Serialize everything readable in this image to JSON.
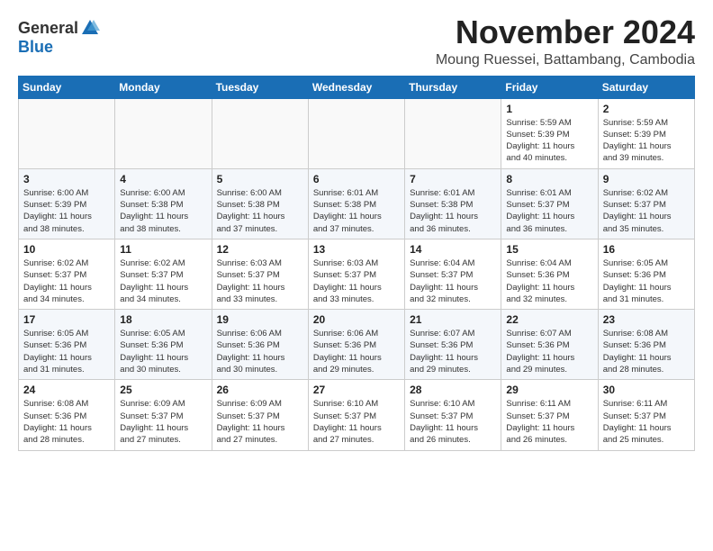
{
  "logo": {
    "general": "General",
    "blue": "Blue"
  },
  "title": "November 2024",
  "location": "Moung Ruessei, Battambang, Cambodia",
  "weekdays": [
    "Sunday",
    "Monday",
    "Tuesday",
    "Wednesday",
    "Thursday",
    "Friday",
    "Saturday"
  ],
  "weeks": [
    [
      {
        "day": "",
        "info": ""
      },
      {
        "day": "",
        "info": ""
      },
      {
        "day": "",
        "info": ""
      },
      {
        "day": "",
        "info": ""
      },
      {
        "day": "",
        "info": ""
      },
      {
        "day": "1",
        "info": "Sunrise: 5:59 AM\nSunset: 5:39 PM\nDaylight: 11 hours\nand 40 minutes."
      },
      {
        "day": "2",
        "info": "Sunrise: 5:59 AM\nSunset: 5:39 PM\nDaylight: 11 hours\nand 39 minutes."
      }
    ],
    [
      {
        "day": "3",
        "info": "Sunrise: 6:00 AM\nSunset: 5:39 PM\nDaylight: 11 hours\nand 38 minutes."
      },
      {
        "day": "4",
        "info": "Sunrise: 6:00 AM\nSunset: 5:38 PM\nDaylight: 11 hours\nand 38 minutes."
      },
      {
        "day": "5",
        "info": "Sunrise: 6:00 AM\nSunset: 5:38 PM\nDaylight: 11 hours\nand 37 minutes."
      },
      {
        "day": "6",
        "info": "Sunrise: 6:01 AM\nSunset: 5:38 PM\nDaylight: 11 hours\nand 37 minutes."
      },
      {
        "day": "7",
        "info": "Sunrise: 6:01 AM\nSunset: 5:38 PM\nDaylight: 11 hours\nand 36 minutes."
      },
      {
        "day": "8",
        "info": "Sunrise: 6:01 AM\nSunset: 5:37 PM\nDaylight: 11 hours\nand 36 minutes."
      },
      {
        "day": "9",
        "info": "Sunrise: 6:02 AM\nSunset: 5:37 PM\nDaylight: 11 hours\nand 35 minutes."
      }
    ],
    [
      {
        "day": "10",
        "info": "Sunrise: 6:02 AM\nSunset: 5:37 PM\nDaylight: 11 hours\nand 34 minutes."
      },
      {
        "day": "11",
        "info": "Sunrise: 6:02 AM\nSunset: 5:37 PM\nDaylight: 11 hours\nand 34 minutes."
      },
      {
        "day": "12",
        "info": "Sunrise: 6:03 AM\nSunset: 5:37 PM\nDaylight: 11 hours\nand 33 minutes."
      },
      {
        "day": "13",
        "info": "Sunrise: 6:03 AM\nSunset: 5:37 PM\nDaylight: 11 hours\nand 33 minutes."
      },
      {
        "day": "14",
        "info": "Sunrise: 6:04 AM\nSunset: 5:37 PM\nDaylight: 11 hours\nand 32 minutes."
      },
      {
        "day": "15",
        "info": "Sunrise: 6:04 AM\nSunset: 5:36 PM\nDaylight: 11 hours\nand 32 minutes."
      },
      {
        "day": "16",
        "info": "Sunrise: 6:05 AM\nSunset: 5:36 PM\nDaylight: 11 hours\nand 31 minutes."
      }
    ],
    [
      {
        "day": "17",
        "info": "Sunrise: 6:05 AM\nSunset: 5:36 PM\nDaylight: 11 hours\nand 31 minutes."
      },
      {
        "day": "18",
        "info": "Sunrise: 6:05 AM\nSunset: 5:36 PM\nDaylight: 11 hours\nand 30 minutes."
      },
      {
        "day": "19",
        "info": "Sunrise: 6:06 AM\nSunset: 5:36 PM\nDaylight: 11 hours\nand 30 minutes."
      },
      {
        "day": "20",
        "info": "Sunrise: 6:06 AM\nSunset: 5:36 PM\nDaylight: 11 hours\nand 29 minutes."
      },
      {
        "day": "21",
        "info": "Sunrise: 6:07 AM\nSunset: 5:36 PM\nDaylight: 11 hours\nand 29 minutes."
      },
      {
        "day": "22",
        "info": "Sunrise: 6:07 AM\nSunset: 5:36 PM\nDaylight: 11 hours\nand 29 minutes."
      },
      {
        "day": "23",
        "info": "Sunrise: 6:08 AM\nSunset: 5:36 PM\nDaylight: 11 hours\nand 28 minutes."
      }
    ],
    [
      {
        "day": "24",
        "info": "Sunrise: 6:08 AM\nSunset: 5:36 PM\nDaylight: 11 hours\nand 28 minutes."
      },
      {
        "day": "25",
        "info": "Sunrise: 6:09 AM\nSunset: 5:37 PM\nDaylight: 11 hours\nand 27 minutes."
      },
      {
        "day": "26",
        "info": "Sunrise: 6:09 AM\nSunset: 5:37 PM\nDaylight: 11 hours\nand 27 minutes."
      },
      {
        "day": "27",
        "info": "Sunrise: 6:10 AM\nSunset: 5:37 PM\nDaylight: 11 hours\nand 27 minutes."
      },
      {
        "day": "28",
        "info": "Sunrise: 6:10 AM\nSunset: 5:37 PM\nDaylight: 11 hours\nand 26 minutes."
      },
      {
        "day": "29",
        "info": "Sunrise: 6:11 AM\nSunset: 5:37 PM\nDaylight: 11 hours\nand 26 minutes."
      },
      {
        "day": "30",
        "info": "Sunrise: 6:11 AM\nSunset: 5:37 PM\nDaylight: 11 hours\nand 25 minutes."
      }
    ]
  ]
}
